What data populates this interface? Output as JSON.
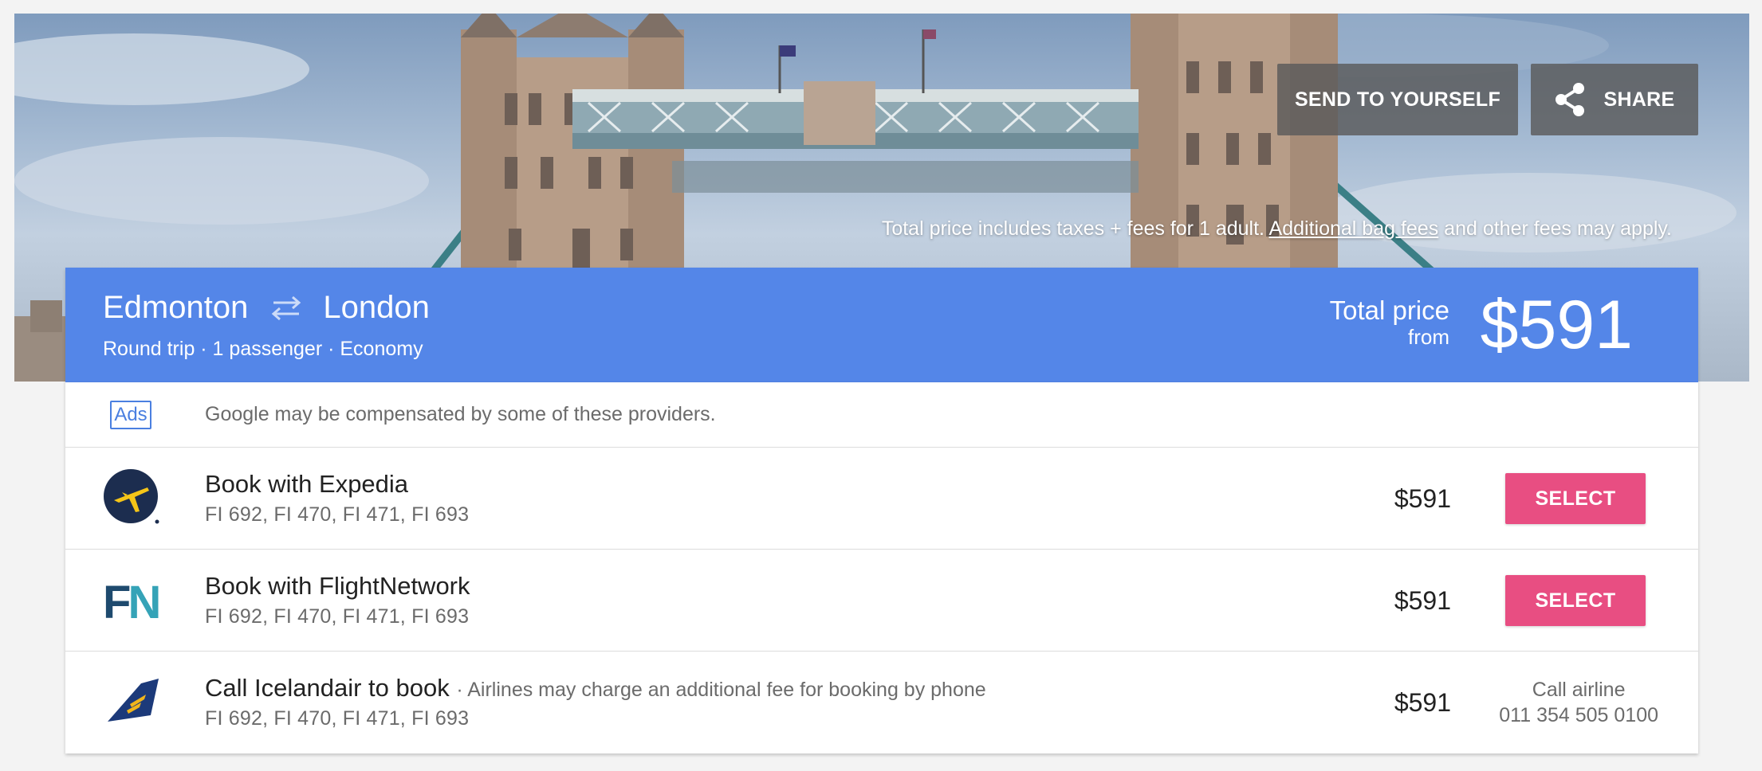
{
  "hero": {
    "send_label": "SEND TO YOURSELF",
    "share_label": "SHARE",
    "note_prefix": "Total price includes taxes + fees for 1 adult.",
    "note_link": "Additional bag fees",
    "note_suffix": "and other fees may apply."
  },
  "trip": {
    "origin": "Edmonton",
    "destination": "London",
    "meta": "Round trip · 1 passenger · Economy",
    "total_label": "Total price",
    "from_label": "from",
    "total_price": "$591",
    "color": "#5486e8"
  },
  "ads": {
    "badge": "Ads",
    "text": "Google may be compensated by some of these providers."
  },
  "providers": [
    {
      "name": "Book with Expedia",
      "flights": "FI 692, FI 470, FI 471, FI 693",
      "price": "$591",
      "action": "SELECT",
      "logo": "expedia-logo"
    },
    {
      "name": "Book with FlightNetwork",
      "logo_text": "FN",
      "flights": "FI 692, FI 470, FI 471, FI 693",
      "price": "$591",
      "action": "SELECT",
      "logo": "flightnetwork-logo"
    },
    {
      "name": "Call Icelandair to book",
      "note": "· Airlines may charge an additional fee for booking by phone",
      "flights": "FI 692, FI 470, FI 471, FI 693",
      "price": "$591",
      "call_label": "Call airline",
      "phone": "011 354 505 0100",
      "logo": "icelandair-logo"
    }
  ],
  "colors": {
    "select": "#e84e82",
    "ads": "#4a7fe0"
  }
}
